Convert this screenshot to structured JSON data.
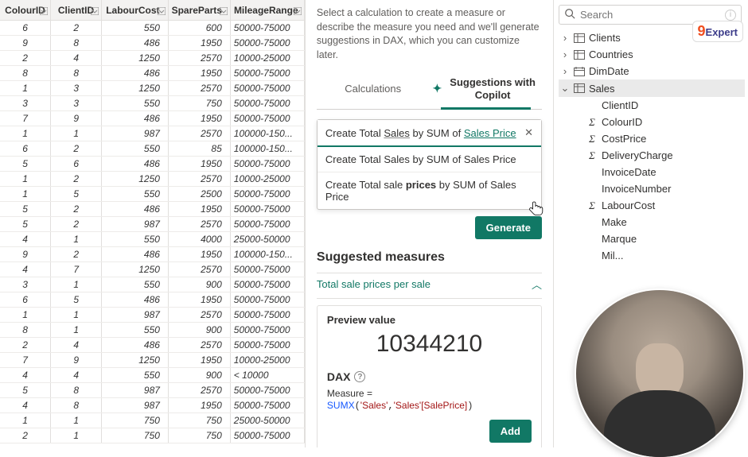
{
  "table": {
    "columns": [
      "ColourID",
      "ClientID",
      "LabourCost",
      "SpareParts",
      "MileageRange"
    ],
    "rows": [
      [
        "6",
        "2",
        "550",
        "600",
        "50000-75000"
      ],
      [
        "9",
        "8",
        "486",
        "1950",
        "50000-75000"
      ],
      [
        "2",
        "4",
        "1250",
        "2570",
        "10000-25000"
      ],
      [
        "8",
        "8",
        "486",
        "1950",
        "50000-75000"
      ],
      [
        "1",
        "3",
        "1250",
        "2570",
        "50000-75000"
      ],
      [
        "3",
        "3",
        "550",
        "750",
        "50000-75000"
      ],
      [
        "7",
        "9",
        "486",
        "1950",
        "50000-75000"
      ],
      [
        "1",
        "1",
        "987",
        "2570",
        "100000-150..."
      ],
      [
        "6",
        "2",
        "550",
        "85",
        "100000-150..."
      ],
      [
        "5",
        "6",
        "486",
        "1950",
        "50000-75000"
      ],
      [
        "1",
        "2",
        "1250",
        "2570",
        "10000-25000"
      ],
      [
        "1",
        "5",
        "550",
        "2500",
        "50000-75000"
      ],
      [
        "5",
        "2",
        "486",
        "1950",
        "50000-75000"
      ],
      [
        "5",
        "2",
        "987",
        "2570",
        "50000-75000"
      ],
      [
        "4",
        "1",
        "550",
        "4000",
        "25000-50000"
      ],
      [
        "9",
        "2",
        "486",
        "1950",
        "100000-150..."
      ],
      [
        "4",
        "7",
        "1250",
        "2570",
        "50000-75000"
      ],
      [
        "3",
        "1",
        "550",
        "900",
        "50000-75000"
      ],
      [
        "6",
        "5",
        "486",
        "1950",
        "50000-75000"
      ],
      [
        "1",
        "1",
        "987",
        "2570",
        "50000-75000"
      ],
      [
        "8",
        "1",
        "550",
        "900",
        "50000-75000"
      ],
      [
        "2",
        "4",
        "486",
        "2570",
        "50000-75000"
      ],
      [
        "7",
        "9",
        "1250",
        "1950",
        "10000-25000"
      ],
      [
        "4",
        "4",
        "550",
        "900",
        "< 10000"
      ],
      [
        "5",
        "8",
        "987",
        "2570",
        "50000-75000"
      ],
      [
        "4",
        "8",
        "987",
        "1950",
        "50000-75000"
      ],
      [
        "1",
        "1",
        "750",
        "750",
        "25000-50000"
      ],
      [
        "2",
        "1",
        "750",
        "750",
        "50000-75000"
      ]
    ]
  },
  "measure": {
    "intro": "Select a calculation to create a measure or describe the measure you need and we'll generate suggestions in DAX, which you can customize later.",
    "tab_calc": "Calculations",
    "tab_copilot": "Suggestions with Copilot",
    "suggestions": [
      "Create Total Sales by SUM of Sales Price",
      "Create Total Sales by SUM of Sales Price",
      "Create Total sale prices by SUM of Sales Price"
    ],
    "generate": "Generate",
    "suggested_title": "Suggested measures",
    "accordion": "Total sale prices per sale",
    "preview_label": "Preview value",
    "preview_value": "10344210",
    "dax_label": "DAX",
    "dax_measure_eq": "Measure =",
    "dax_fn": "SUMX",
    "dax_arg1": "'Sales'",
    "dax_arg2": "'Sales'[SalePrice]",
    "add": "Add"
  },
  "fields": {
    "search_placeholder": "Search",
    "tables": {
      "clients": "Clients",
      "countries": "Countries",
      "dimdate": "DimDate",
      "sales": "Sales"
    },
    "sales_fields": [
      {
        "icon": "",
        "label": "ClientID"
      },
      {
        "icon": "Σ",
        "label": "ColourID"
      },
      {
        "icon": "Σ",
        "label": "CostPrice"
      },
      {
        "icon": "Σ",
        "label": "DeliveryCharge"
      },
      {
        "icon": "",
        "label": "InvoiceDate"
      },
      {
        "icon": "",
        "label": "InvoiceNumber"
      },
      {
        "icon": "Σ",
        "label": "LabourCost"
      },
      {
        "icon": "",
        "label": "Make"
      },
      {
        "icon": "",
        "label": "Marque"
      },
      {
        "icon": "",
        "label": "Mil..."
      }
    ],
    "logo_text": "Expert",
    "logo_nine": "9"
  }
}
